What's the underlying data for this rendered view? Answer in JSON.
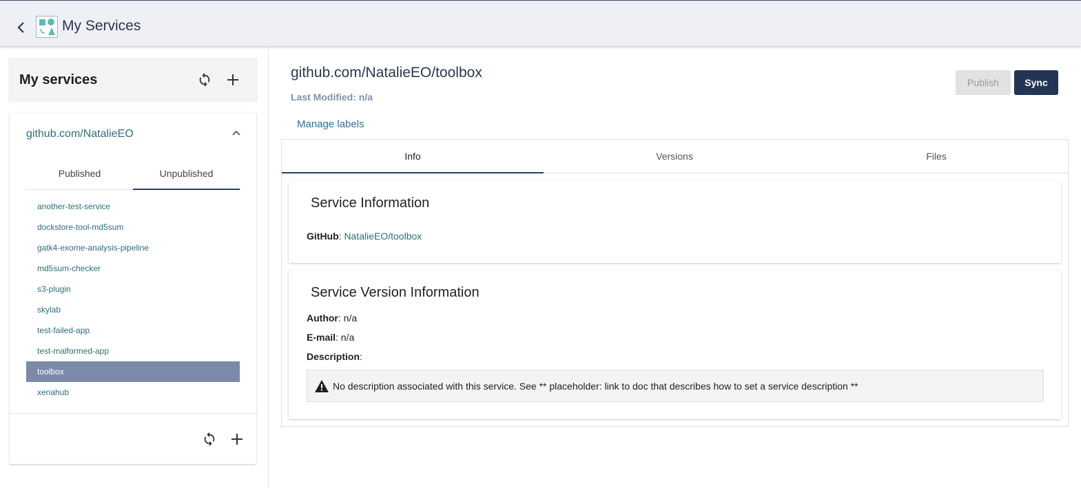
{
  "header": {
    "title": "My Services",
    "back_icon": "chevron-left-icon",
    "logo_icon": "service-logo-icon"
  },
  "sidebar": {
    "title": "My services",
    "org": "github.com/NatalieEO",
    "tabs": [
      "Published",
      "Unpublished"
    ],
    "active_tab": "Unpublished",
    "services": [
      "another-test-service",
      "dockstore-tool-md5sum",
      "gatk4-exome-analysis-pipeline",
      "md5sum-checker",
      "s3-plugin",
      "skylab",
      "test-failed-app",
      "test-malformed-app",
      "toolbox",
      "xenahub"
    ],
    "selected_service": "toolbox"
  },
  "main": {
    "title": "github.com/NatalieEO/toolbox",
    "last_modified_label": "Last Modified: n/a",
    "publish_label": "Publish",
    "sync_label": "Sync",
    "manage_labels": "Manage labels",
    "tabs": [
      "Info",
      "Versions",
      "Files"
    ],
    "active_tab": "Info",
    "service_info": {
      "title": "Service Information",
      "github_label": "GitHub",
      "github_value": "NatalieEO/toolbox"
    },
    "version_info": {
      "title": "Service Version Information",
      "author_label": "Author",
      "author_value": "n/a",
      "email_label": "E-mail",
      "email_value": "n/a",
      "description_label": "Description",
      "notice": "No description associated with this service. See ** placeholder: link to doc that describes how to set a service description **"
    }
  },
  "colors": {
    "accent": "#243455",
    "link": "#2c6e7a",
    "selected": "#7b8aa8",
    "header_bg": "#eef0f6"
  }
}
